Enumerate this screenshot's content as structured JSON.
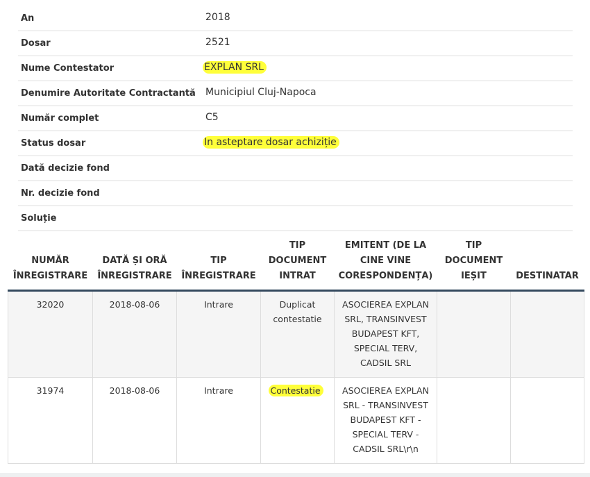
{
  "details": [
    {
      "label": "An",
      "value": "2018",
      "highlight": false
    },
    {
      "label": "Dosar",
      "value": "2521",
      "highlight": false
    },
    {
      "label": "Nume Contestator",
      "value": "EXPLAN SRL",
      "highlight": true
    },
    {
      "label": "Denumire Autoritate Contractantă",
      "value": "Municipiul Cluj-Napoca",
      "highlight": false
    },
    {
      "label": "Număr complet",
      "value": "C5",
      "highlight": false
    },
    {
      "label": "Status dosar",
      "value": "In asteptare dosar achiziție",
      "highlight": true
    },
    {
      "label": "Dată decizie fond",
      "value": "",
      "highlight": false
    },
    {
      "label": "Nr. decizie fond",
      "value": "",
      "highlight": false
    },
    {
      "label": "Soluție",
      "value": "",
      "highlight": false
    }
  ],
  "table": {
    "headers": [
      "NUMĂR ÎNREGISTRARE",
      "DATĂ ȘI ORĂ ÎNREGISTRARE",
      "TIP ÎNREGISTRARE",
      "TIP DOCUMENT INTRAT",
      "EMITENT (DE LA CINE VINE CORESPONDENȚA)",
      "TIP DOCUMENT IEȘIT",
      "DESTINATAR"
    ],
    "rows": [
      {
        "numar": "32020",
        "data": "2018-08-06",
        "tip_inregistrare": "Intrare",
        "tip_document_intrat": "Duplicat contestatie",
        "emitent": "ASOCIEREA EXPLAN SRL, TRANSINVEST BUDAPEST KFT, SPECIAL TERV, CADSIL SRL",
        "tip_document_iesit": "",
        "destinatar": ""
      },
      {
        "numar": "31974",
        "data": "2018-08-06",
        "tip_inregistrare": "Intrare",
        "tip_document_intrat": "Contestatie",
        "emitent": "ASOCIEREA EXPLAN SRL - TRANSINVEST BUDAPEST KFT - SPECIAL TERV - CADSIL SRL\\r\\n",
        "tip_document_iesit": "",
        "destinatar": ""
      }
    ]
  },
  "colors": {
    "highlight": "#ffff3a",
    "header_border": "#34495e",
    "row_alt": "#f5f5f5"
  }
}
